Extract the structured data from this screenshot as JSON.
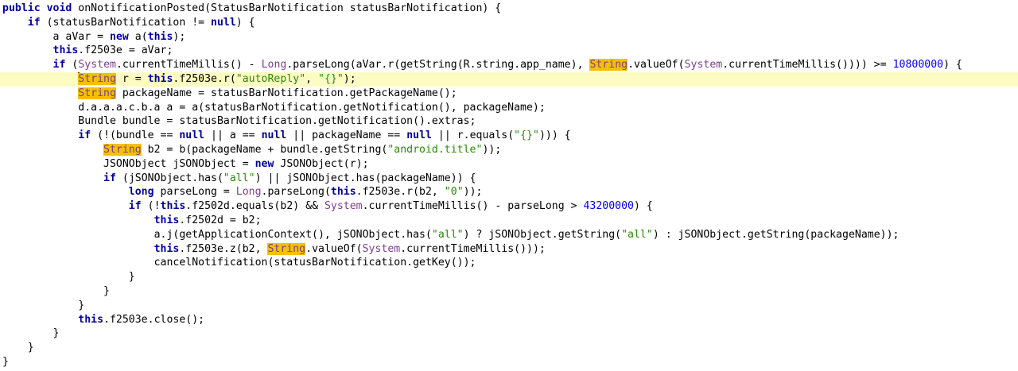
{
  "editor": {
    "indent_unit": "    ",
    "colors": {
      "keyword": "#00009e",
      "type": "#7d3f8e",
      "string": "#2a8a00",
      "number": "#0000f0",
      "search_highlight": "#f5c000",
      "current_line": "#fcfcc2",
      "caret": "#d00000"
    },
    "current_line_index": 5,
    "search_term": "String",
    "lines": [
      {
        "indent": 0,
        "tokens": [
          {
            "t": "public",
            "k": "kw"
          },
          {
            "t": " "
          },
          {
            "t": "void",
            "k": "kw"
          },
          {
            "t": " onNotificationPosted(StatusBarNotification statusBarNotification) {"
          }
        ]
      },
      {
        "indent": 1,
        "tokens": [
          {
            "t": "if",
            "k": "kw"
          },
          {
            "t": " (statusBarNotification != "
          },
          {
            "t": "null",
            "k": "kw"
          },
          {
            "t": ") {"
          }
        ]
      },
      {
        "indent": 2,
        "tokens": [
          {
            "t": "a aVar = "
          },
          {
            "t": "new",
            "k": "kw"
          },
          {
            "t": " a("
          },
          {
            "t": "this",
            "k": "kw"
          },
          {
            "t": ");"
          }
        ]
      },
      {
        "indent": 2,
        "tokens": [
          {
            "t": "this",
            "k": "kw"
          },
          {
            "t": ".f2503e = aVar;"
          }
        ]
      },
      {
        "indent": 2,
        "tokens": [
          {
            "t": "if",
            "k": "kw"
          },
          {
            "t": " ("
          },
          {
            "t": "System",
            "k": "cls"
          },
          {
            "t": ".currentTimeMillis() - "
          },
          {
            "t": "Long",
            "k": "cls"
          },
          {
            "t": ".parseLong(aVar.r(getString(R.string.app_name), "
          },
          {
            "t": "String",
            "k": "hl"
          },
          {
            "t": ".valueOf("
          },
          {
            "t": "System",
            "k": "cls"
          },
          {
            "t": ".currentTimeMillis()))) >= "
          },
          {
            "t": "10800000",
            "k": "num"
          },
          {
            "t": ") {"
          }
        ]
      },
      {
        "indent": 3,
        "tokens": [
          {
            "t": "String",
            "k": "hl",
            "caret": true
          },
          {
            "t": " r = "
          },
          {
            "t": "this",
            "k": "kw"
          },
          {
            "t": ".f2503e.r("
          },
          {
            "t": "\"autoReply\"",
            "k": "str"
          },
          {
            "t": ", "
          },
          {
            "t": "\"{}\"",
            "k": "str"
          },
          {
            "t": ");"
          }
        ]
      },
      {
        "indent": 3,
        "tokens": [
          {
            "t": "String",
            "k": "hl"
          },
          {
            "t": " packageName = statusBarNotification.getPackageName();"
          }
        ]
      },
      {
        "indent": 3,
        "tokens": [
          {
            "t": "d.a.a.a.c.b.a a = a(statusBarNotification.getNotification(), packageName);"
          }
        ]
      },
      {
        "indent": 3,
        "tokens": [
          {
            "t": "Bundle bundle = statusBarNotification.getNotification().extras;"
          }
        ]
      },
      {
        "indent": 3,
        "tokens": [
          {
            "t": "if",
            "k": "kw"
          },
          {
            "t": " (!(bundle == "
          },
          {
            "t": "null",
            "k": "kw"
          },
          {
            "t": " || a == "
          },
          {
            "t": "null",
            "k": "kw"
          },
          {
            "t": " || packageName == "
          },
          {
            "t": "null",
            "k": "kw"
          },
          {
            "t": " || r.equals("
          },
          {
            "t": "\"{}\"",
            "k": "str"
          },
          {
            "t": "))) {"
          }
        ]
      },
      {
        "indent": 4,
        "tokens": [
          {
            "t": "String",
            "k": "hl"
          },
          {
            "t": " b2 = b(packageName + bundle.getString("
          },
          {
            "t": "\"android.title\"",
            "k": "str"
          },
          {
            "t": "));"
          }
        ]
      },
      {
        "indent": 4,
        "tokens": [
          {
            "t": "JSONObject jSONObject = "
          },
          {
            "t": "new",
            "k": "kw"
          },
          {
            "t": " JSONObject(r);"
          }
        ]
      },
      {
        "indent": 4,
        "tokens": [
          {
            "t": "if",
            "k": "kw"
          },
          {
            "t": " (jSONObject.has("
          },
          {
            "t": "\"all\"",
            "k": "str"
          },
          {
            "t": ") || jSONObject.has(packageName)) {"
          }
        ]
      },
      {
        "indent": 5,
        "tokens": [
          {
            "t": "long",
            "k": "kw"
          },
          {
            "t": " parseLong = "
          },
          {
            "t": "Long",
            "k": "cls"
          },
          {
            "t": ".parseLong("
          },
          {
            "t": "this",
            "k": "kw"
          },
          {
            "t": ".f2503e.r(b2, "
          },
          {
            "t": "\"0\"",
            "k": "str"
          },
          {
            "t": "));"
          }
        ]
      },
      {
        "indent": 5,
        "tokens": [
          {
            "t": "if",
            "k": "kw"
          },
          {
            "t": " (!"
          },
          {
            "t": "this",
            "k": "kw"
          },
          {
            "t": ".f2502d.equals(b2) && "
          },
          {
            "t": "System",
            "k": "cls"
          },
          {
            "t": ".currentTimeMillis() - parseLong > "
          },
          {
            "t": "43200000",
            "k": "num"
          },
          {
            "t": ") {"
          }
        ]
      },
      {
        "indent": 6,
        "tokens": [
          {
            "t": "this",
            "k": "kw"
          },
          {
            "t": ".f2502d = b2;"
          }
        ]
      },
      {
        "indent": 6,
        "tokens": [
          {
            "t": "a.j(getApplicationContext(), jSONObject.has("
          },
          {
            "t": "\"all\"",
            "k": "str"
          },
          {
            "t": ") ? jSONObject.getString("
          },
          {
            "t": "\"all\"",
            "k": "str"
          },
          {
            "t": ") : jSONObject.getString(packageName));"
          }
        ]
      },
      {
        "indent": 6,
        "tokens": [
          {
            "t": "this",
            "k": "kw"
          },
          {
            "t": ".f2503e.z(b2, "
          },
          {
            "t": "String",
            "k": "hl"
          },
          {
            "t": ".valueOf("
          },
          {
            "t": "System",
            "k": "cls"
          },
          {
            "t": ".currentTimeMillis()));"
          }
        ]
      },
      {
        "indent": 6,
        "tokens": [
          {
            "t": "cancelNotification(statusBarNotification.getKey());"
          }
        ]
      },
      {
        "indent": 5,
        "tokens": [
          {
            "t": "}"
          }
        ]
      },
      {
        "indent": 4,
        "tokens": [
          {
            "t": "}"
          }
        ]
      },
      {
        "indent": 3,
        "tokens": [
          {
            "t": "}"
          }
        ]
      },
      {
        "indent": 3,
        "tokens": [
          {
            "t": "this",
            "k": "kw"
          },
          {
            "t": ".f2503e.close();"
          }
        ]
      },
      {
        "indent": 2,
        "tokens": [
          {
            "t": "}"
          }
        ]
      },
      {
        "indent": 1,
        "tokens": [
          {
            "t": "}"
          }
        ]
      },
      {
        "indent": 0,
        "tokens": [
          {
            "t": "}"
          }
        ]
      }
    ]
  }
}
